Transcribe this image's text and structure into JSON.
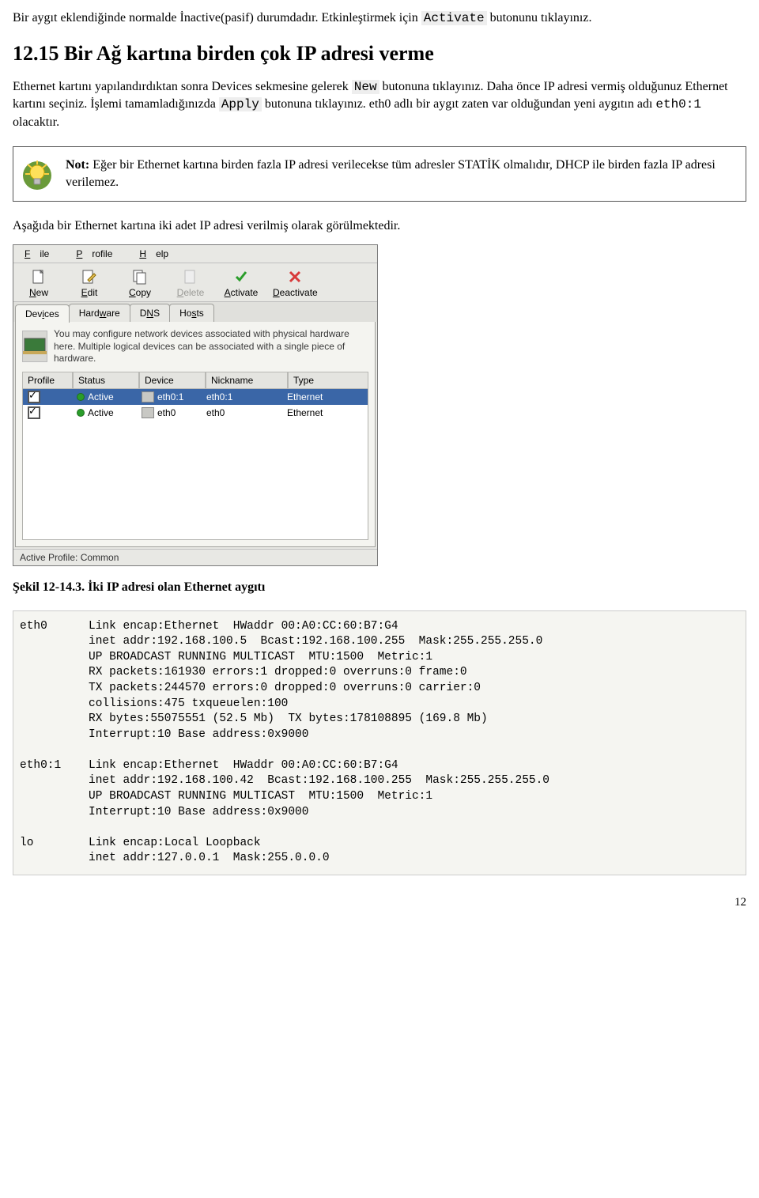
{
  "intro": {
    "p1a": "Bir aygıt eklendiğinde normalde İnactive(pasif) durumdadır. Etkinleştirmek için ",
    "p1_code": "Activate",
    "p1b": " butonunu tıklayınız."
  },
  "heading": "12.15 Bir Ağ kartına birden çok IP adresi verme",
  "para2": {
    "a": "Ethernet kartını yapılandırdıktan sonra Devices sekmesine gelerek ",
    "code1": "New",
    "b": " butonuna tıklayınız. Daha önce IP adresi vermiş olduğunuz Ethernet kartını seçiniz. İşlemi tamamladığınızda ",
    "code2": "Apply",
    "c": " butonuna tıklayınız. eth0 adlı bir aygıt zaten var olduğundan yeni aygıtın adı ",
    "mono": "eth0:1",
    "d": " olacaktır."
  },
  "note": {
    "prefix": "Not:",
    "text": " Eğer bir Ethernet kartına birden fazla IP adresi verilecekse tüm adresler STATİK olmalıdır, DHCP ile birden fazla IP adresi verilemez."
  },
  "para3": "Aşağıda bir Ethernet kartına iki adet IP adresi verilmiş olarak görülmektedir.",
  "window": {
    "menus": {
      "file_m": "F",
      "file": "ile",
      "profile_m": "P",
      "profile": "rofile",
      "help_m": "H",
      "help": "elp"
    },
    "toolbar": {
      "new_m": "N",
      "new": "ew",
      "edit_m": "E",
      "edit": "dit",
      "copy_m": "C",
      "copy": "opy",
      "delete_m": "D",
      "delete": "elete",
      "activate_m": "A",
      "activate": "ctivate",
      "deactivate_m": "D",
      "deactivate": "eactivate"
    },
    "tabs": {
      "devices": "Devices",
      "devices_m": "i",
      "hardware": "Hardware",
      "hardware_m": "w",
      "dns": "DNS",
      "dns_m": "N",
      "hosts": "Hosts",
      "hosts_m": "s"
    },
    "info": "You may configure network devices associated with physical hardware here.  Multiple logical devices can be associated with a single piece of hardware.",
    "headers": {
      "profile": "Profile",
      "status": "Status",
      "device": "Device",
      "nickname": "Nickname",
      "type": "Type"
    },
    "rows": [
      {
        "status": "Active",
        "device": "eth0:1",
        "nickname": "eth0:1",
        "type": "Ethernet"
      },
      {
        "status": "Active",
        "device": "eth0",
        "nickname": "eth0",
        "type": "Ethernet"
      }
    ],
    "statusbar": "Active Profile: Common"
  },
  "caption": "Şekil 12-14.3. İki IP adresi olan Ethernet aygıtı",
  "terminal": "eth0      Link encap:Ethernet  HWaddr 00:A0:CC:60:B7:G4\n          inet addr:192.168.100.5  Bcast:192.168.100.255  Mask:255.255.255.0\n          UP BROADCAST RUNNING MULTICAST  MTU:1500  Metric:1\n          RX packets:161930 errors:1 dropped:0 overruns:0 frame:0\n          TX packets:244570 errors:0 dropped:0 overruns:0 carrier:0\n          collisions:475 txqueuelen:100\n          RX bytes:55075551 (52.5 Mb)  TX bytes:178108895 (169.8 Mb)\n          Interrupt:10 Base address:0x9000\n\neth0:1    Link encap:Ethernet  HWaddr 00:A0:CC:60:B7:G4\n          inet addr:192.168.100.42  Bcast:192.168.100.255  Mask:255.255.255.0\n          UP BROADCAST RUNNING MULTICAST  MTU:1500  Metric:1\n          Interrupt:10 Base address:0x9000\n\nlo        Link encap:Local Loopback\n          inet addr:127.0.0.1  Mask:255.0.0.0",
  "pagenum": "12"
}
